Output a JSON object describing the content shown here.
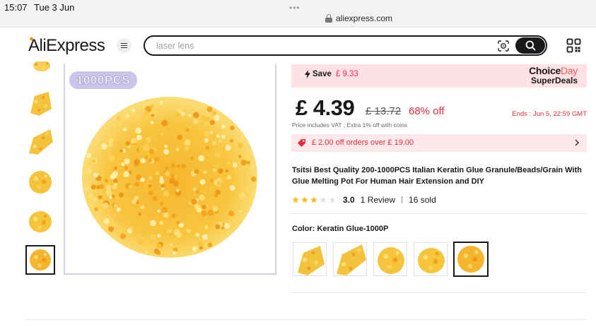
{
  "status_bar": {
    "time": "15:07",
    "date": "Tue 3 Jun",
    "url": "aliexpress.com"
  },
  "header": {
    "logo": "AliExpress",
    "search_placeholder": "laser lens"
  },
  "gallery": {
    "badge": "1000PCS",
    "thumbnail_count": 6,
    "selected_thumbnail": 6
  },
  "deal": {
    "save_label": "Save",
    "save_amount": "£ 9.33",
    "choice_prefix": "Choice",
    "choice_day": "Day",
    "super_deals": "SuperDeals"
  },
  "pricing": {
    "price": "£ 4.39",
    "original_price": "£ 13.72",
    "discount": "68% off",
    "ends": "Ends : Jun 5, 22:59 GMT",
    "vat_note": "Price includes VAT ; Extra 1% off with coins"
  },
  "coupon": {
    "text": "£ 2.00 off orders over £ 19.00"
  },
  "product": {
    "title": "Tsitsi Best Quality 200-1000PCS Italian Keratin Glue Granule/Beads/Grain With Glue Melting Pot For Human Hair Extension and DIY",
    "rating": "3.0",
    "stars_filled": 3,
    "stars_total": 5,
    "reviews": "1 Review",
    "sold": "16 sold"
  },
  "variant": {
    "label": "Color: Keratin Glue-1000P",
    "swatch_count": 5,
    "selected_swatch": 5
  },
  "colors": {
    "accent_red": "#e0303d",
    "deal_bg": "#fde1e4",
    "glue_yellow": "#f7c53a"
  }
}
